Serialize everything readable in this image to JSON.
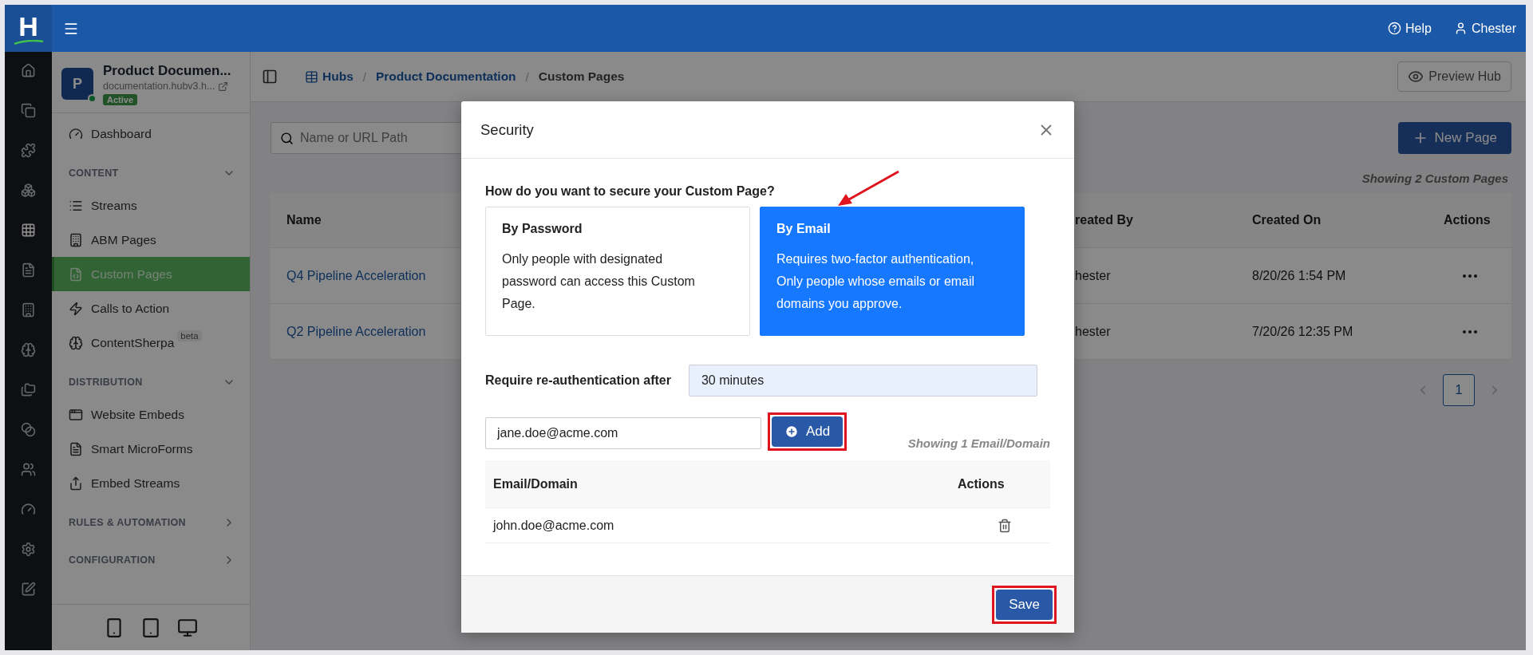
{
  "topbar": {
    "logo": "H",
    "help": "Help",
    "user": "Chester"
  },
  "rail": [
    {
      "selected": false
    },
    {
      "selected": false
    },
    {
      "selected": false
    },
    {
      "selected": false
    },
    {
      "selected": true
    },
    {
      "selected": false
    },
    {
      "selected": false
    },
    {
      "selected": false
    },
    {
      "selected": false
    },
    {
      "selected": false
    },
    {
      "selected": false
    },
    {
      "selected": false
    },
    {
      "selected": false
    },
    {
      "selected": false
    }
  ],
  "hub": {
    "initial": "P",
    "title": "Product Documen...",
    "url": "documentation.hubv3.h...",
    "status": "Active",
    "online": true
  },
  "sidebar": {
    "items": [
      {
        "kind": "item",
        "label": "Dashboard",
        "selected": false
      },
      {
        "kind": "section",
        "label": "CONTENT",
        "expanded": true
      },
      {
        "kind": "item",
        "label": "Streams",
        "selected": false
      },
      {
        "kind": "item",
        "label": "ABM Pages",
        "selected": false
      },
      {
        "kind": "item",
        "label": "Custom Pages",
        "selected": true
      },
      {
        "kind": "item",
        "label": "Calls to Action",
        "selected": false
      },
      {
        "kind": "item",
        "label": "ContentSherpa",
        "selected": false,
        "badge": "beta"
      },
      {
        "kind": "section",
        "label": "DISTRIBUTION",
        "expanded": true
      },
      {
        "kind": "item",
        "label": "Website Embeds",
        "selected": false
      },
      {
        "kind": "item",
        "label": "Smart MicroForms",
        "selected": false
      },
      {
        "kind": "item",
        "label": "Embed Streams",
        "selected": false
      },
      {
        "kind": "section",
        "label": "RULES & AUTOMATION",
        "expanded": false
      },
      {
        "kind": "section",
        "label": "CONFIGURATION",
        "expanded": false
      }
    ]
  },
  "breadcrumb": [
    {
      "label": "Hubs",
      "link": true,
      "separator": "/"
    },
    {
      "label": "Product Documentation",
      "link": true,
      "separator": "/"
    },
    {
      "label": "Custom Pages",
      "link": false
    }
  ],
  "preview_button": "Preview Hub",
  "search": {
    "placeholder": "Name or URL Path"
  },
  "new_button": "New Page",
  "showing": "Showing 2 Custom Pages",
  "table": {
    "columns": [
      "Name",
      "reated By",
      "Created On",
      "Actions"
    ],
    "rows": [
      {
        "name": "Q4 Pipeline Acceleration",
        "created_by": "hester",
        "created_on": "8/20/26 1:54 PM"
      },
      {
        "name": "Q2 Pipeline Acceleration",
        "created_by": "hester",
        "created_on": "7/20/26 12:35 PM"
      }
    ]
  },
  "pagination": [
    {
      "label": "1",
      "selected": true
    }
  ],
  "modal": {
    "title": "Security",
    "question": "How do you want to secure your Custom Page?",
    "options": [
      {
        "title": "By Password",
        "description": "Only people with designated password can access this Custom Page.",
        "selected": false,
        "arrow": false
      },
      {
        "title": "By Email",
        "description": "Requires two-factor authentication, Only people whose emails or email domains you approve.",
        "selected": true,
        "arrow": true
      }
    ],
    "reauth_label": "Require re-authentication after",
    "reauth_value": "30 minutes",
    "email_value": "jane.doe@acme.com",
    "add_button": {
      "label": "Add",
      "highlighted": true
    },
    "showing": "Showing 1 Email/Domain",
    "columns": [
      "Email/Domain",
      "Actions"
    ],
    "rows": [
      {
        "email": "john.doe@acme.com"
      }
    ],
    "save_button": {
      "label": "Save",
      "highlighted": true
    }
  }
}
